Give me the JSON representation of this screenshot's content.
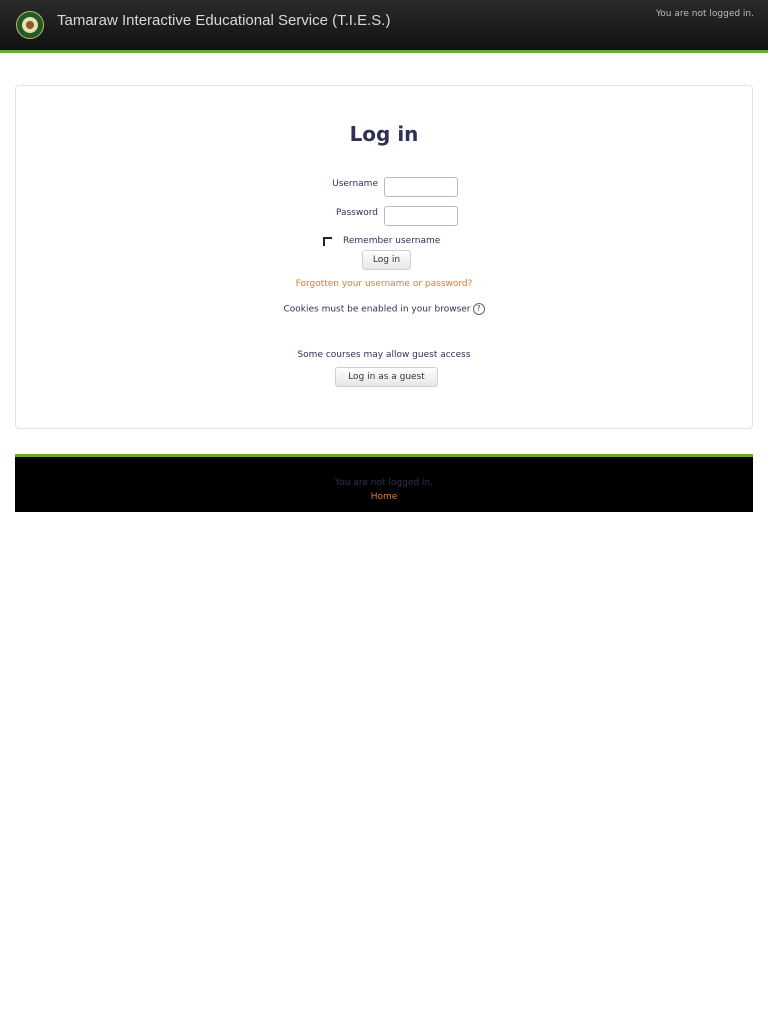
{
  "header": {
    "site_title": "Tamaraw Interactive Educational Service (T.I.E.S.)",
    "login_info": "You are not logged in.",
    "logo_icon": "school-seal-icon"
  },
  "login": {
    "heading": "Log in",
    "username_label": "Username",
    "username_value": "",
    "password_label": "Password",
    "password_value": "",
    "remember_label": "Remember username",
    "remember_checked": false,
    "submit_label": "Log in",
    "forgot_link": "Forgotten your username or password?",
    "cookies_notice": "Cookies must be enabled in your browser",
    "help_icon": "question-circle-icon",
    "guest_notice": "Some courses may allow guest access",
    "guest_button": "Log in as a guest"
  },
  "footer": {
    "login_info": "You are not logged in.",
    "home_link": "Home"
  },
  "colors": {
    "accent_green": "#6aa832",
    "link_orange": "#e8792e",
    "text_navy": "#2f2f5a",
    "header_bg": "#1a1a1a",
    "footer_bg": "#000000"
  }
}
